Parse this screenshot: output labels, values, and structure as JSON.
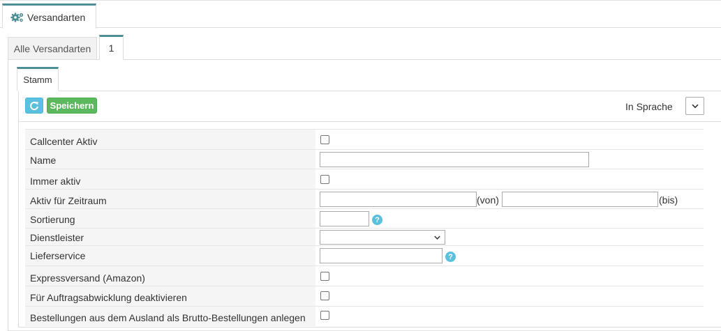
{
  "top_tab": {
    "label": "Versandarten",
    "icon": "gears-icon"
  },
  "record_tabs": [
    {
      "label": "Alle Versandarten"
    },
    {
      "label": "1"
    }
  ],
  "inner_tab": {
    "label": "Stamm"
  },
  "toolbar": {
    "refresh_icon": "refresh-icon",
    "save_label": "Speichern",
    "language_label": "In Sprache",
    "language_value": ""
  },
  "form": {
    "callcenter_aktiv": {
      "label": "Callcenter Aktiv",
      "checked": false
    },
    "name": {
      "label": "Name",
      "value": ""
    },
    "immer_aktiv": {
      "label": "Immer aktiv",
      "checked": false
    },
    "aktiv_fuer_zeitraum": {
      "label": "Aktiv für Zeitraum",
      "von_value": "",
      "von_suffix": "(von)",
      "bis_value": "",
      "bis_suffix": "(bis)"
    },
    "sortierung": {
      "label": "Sortierung",
      "value": ""
    },
    "dienstleister": {
      "label": "Dienstleister",
      "value": ""
    },
    "lieferservice": {
      "label": "Lieferservice",
      "value": ""
    },
    "expressversand": {
      "label": "Expressversand (Amazon)",
      "checked": false
    },
    "auftragsabwicklung": {
      "label": "Für Auftragsabwicklung deaktivieren",
      "checked": false
    },
    "brutto_bestellungen": {
      "label": "Bestellungen aus dem Ausland als Brutto-Bestellungen anlegen",
      "checked": false
    }
  },
  "colors": {
    "accent": "#4d8f95",
    "save": "#5cb85c",
    "info": "#5bc0de"
  }
}
